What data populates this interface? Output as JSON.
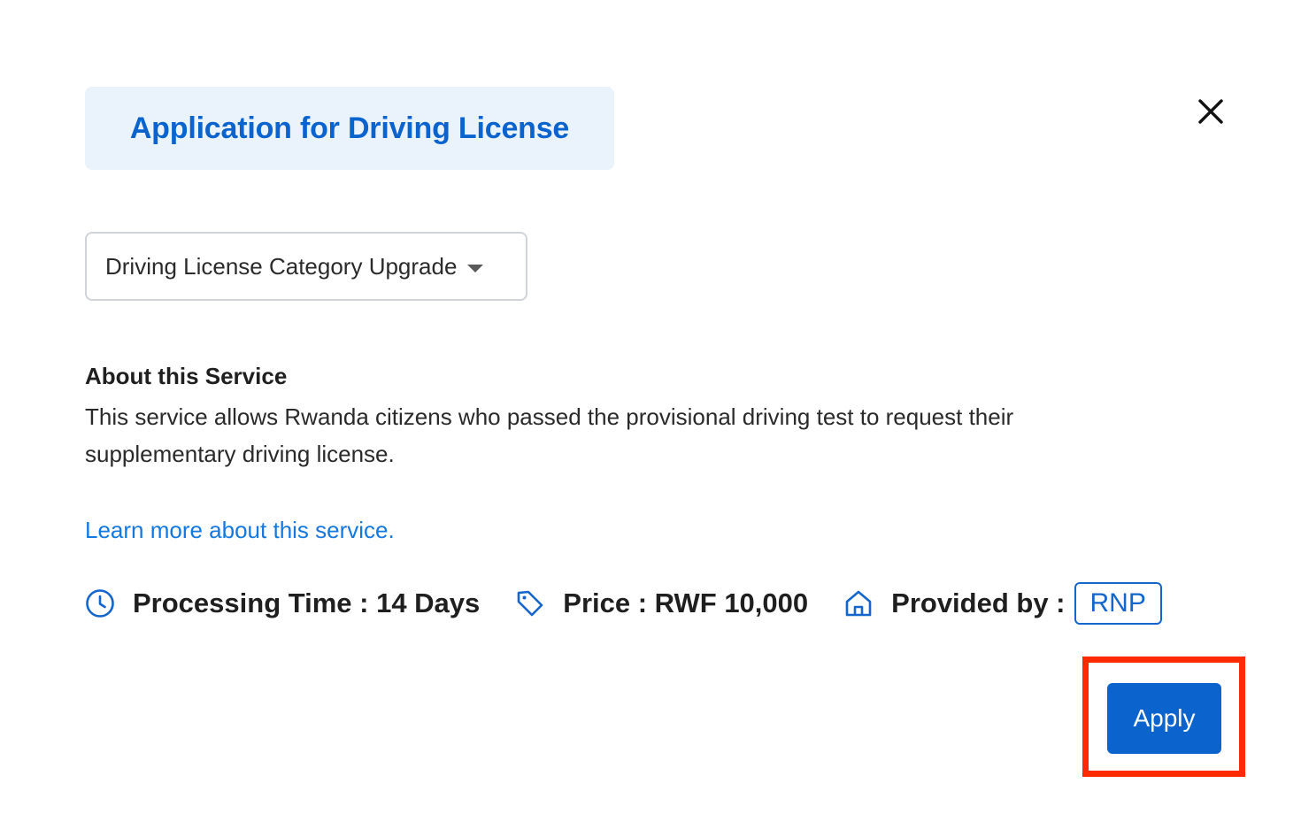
{
  "dialog": {
    "title": "Application for Driving License",
    "close_icon": "close-icon"
  },
  "service_select": {
    "selected": "Driving License Category Upgrade",
    "caret_icon": "caret-down-icon"
  },
  "about": {
    "heading": "About this Service",
    "description": "This service allows Rwanda citizens who passed the provisional driving test to request their supplementary driving license."
  },
  "learn_more": {
    "label": "Learn more about this service."
  },
  "meta": {
    "processing_time": {
      "icon": "clock-icon",
      "label": "Processing Time : 14 Days"
    },
    "price": {
      "icon": "price-tag-icon",
      "label": "Price : RWF 10,000"
    },
    "provider": {
      "icon": "home-icon",
      "label": "Provided by :",
      "value": "RNP"
    }
  },
  "actions": {
    "apply_label": "Apply"
  },
  "colors": {
    "primary": "#0b63ce",
    "link": "#1478e0",
    "title_bg": "#eaf2fc",
    "highlight": "#ff2a00"
  }
}
